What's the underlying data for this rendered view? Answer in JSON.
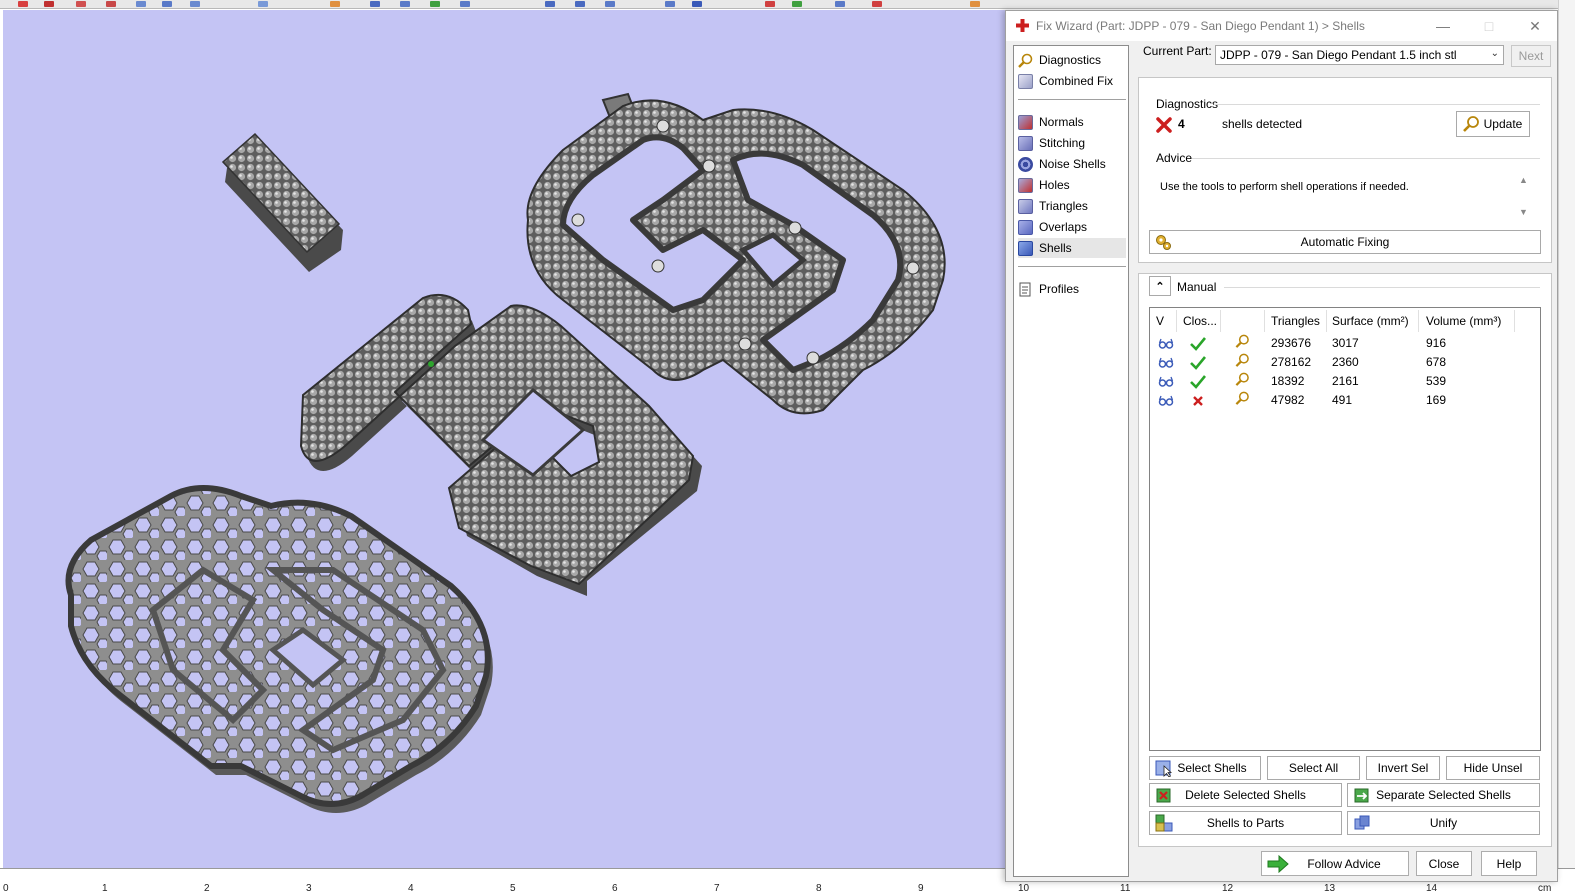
{
  "window": {
    "title": "Fix Wizard (Part: JDPP - 079 - San Diego Pendant 1) > Shells",
    "minimize": "—",
    "maximize": "□",
    "close": "✕"
  },
  "nav": {
    "items": [
      {
        "label": "Diagnostics",
        "icon": "diagnostics-magnifier-icon"
      },
      {
        "label": "Combined Fix",
        "icon": "combined-fix-icon"
      },
      {
        "label": "Normals",
        "icon": "normals-icon"
      },
      {
        "label": "Stitching",
        "icon": "stitching-icon"
      },
      {
        "label": "Noise Shells",
        "icon": "noise-shells-icon"
      },
      {
        "label": "Holes",
        "icon": "holes-icon"
      },
      {
        "label": "Triangles",
        "icon": "triangles-icon"
      },
      {
        "label": "Overlaps",
        "icon": "overlaps-icon"
      },
      {
        "label": "Shells",
        "icon": "shells-icon",
        "selected": true
      },
      {
        "label": "Profiles",
        "icon": "profiles-icon"
      }
    ]
  },
  "part": {
    "label": "Current Part:",
    "value": "JDPP - 079 - San Diego Pendant 1.5 inch stl",
    "next_label": "Next"
  },
  "diagnostics": {
    "title": "Diagnostics",
    "count": "4",
    "status_text": "shells detected",
    "update_label": "Update"
  },
  "advice": {
    "title": "Advice",
    "text": "Use the tools to perform shell operations if needed.",
    "auto_fix_label": "Automatic Fixing"
  },
  "manual": {
    "title": "Manual",
    "columns": [
      "V",
      "Clos...",
      "",
      "Triangles",
      "Surface (mm²)",
      "Volume (mm³)"
    ],
    "rows": [
      {
        "closed": true,
        "triangles": "293676",
        "surface": "3017",
        "volume": "916"
      },
      {
        "closed": true,
        "triangles": "278162",
        "surface": "2360",
        "volume": "678"
      },
      {
        "closed": true,
        "triangles": "18392",
        "surface": "2161",
        "volume": "539"
      },
      {
        "closed": false,
        "triangles": "47982",
        "surface": "491",
        "volume": "169"
      }
    ],
    "buttons": {
      "select_shells": "Select Shells",
      "select_all": "Select All",
      "invert_sel": "Invert Sel",
      "hide_unsel": "Hide Unsel",
      "delete_selected": "Delete Selected Shells",
      "separate_selected": "Separate Selected Shells",
      "shells_to_parts": "Shells to Parts",
      "unify": "Unify"
    }
  },
  "footer": {
    "follow_advice": "Follow Advice",
    "close": "Close",
    "help": "Help"
  },
  "ruler": {
    "ticks": [
      "0",
      "1",
      "2",
      "3",
      "4",
      "5",
      "6",
      "7",
      "8",
      "9",
      "10",
      "11",
      "12",
      "13",
      "14"
    ],
    "unit": "cm"
  },
  "colors": {
    "viewport_bg": "#c4c4f4",
    "model_gray": "#8a8a8a",
    "accent_red": "#cc1f1f",
    "check_green": "#2aa52a"
  }
}
